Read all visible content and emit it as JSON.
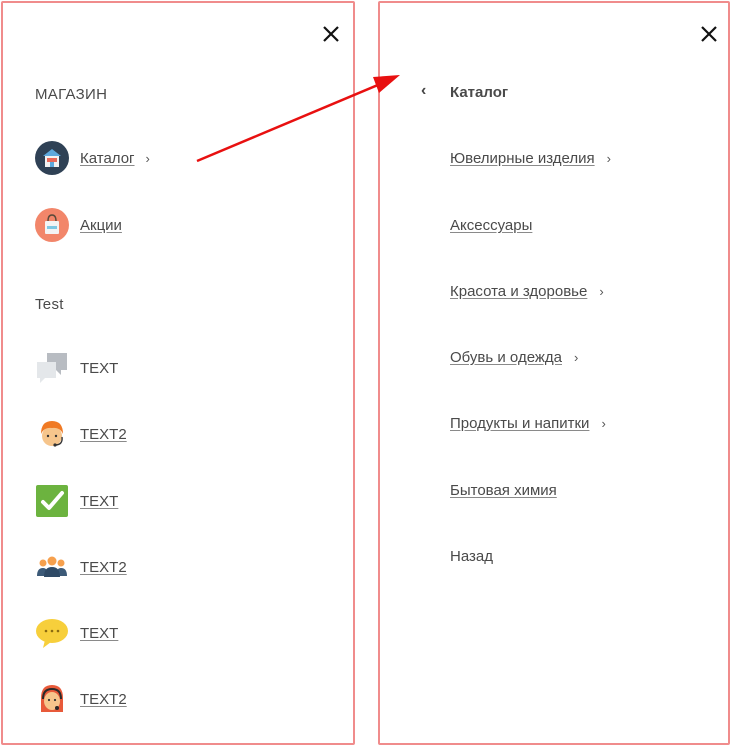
{
  "left_panel": {
    "section_shop": "МАГАЗИН",
    "catalog_label": "Каталог",
    "catalog_chevron": "›",
    "promo_label": "Акции",
    "section_test": "Test",
    "items": [
      {
        "label": "TEXT",
        "icon": "chat-bubbles-icon"
      },
      {
        "label": "TEXT2",
        "icon": "support-agent-icon"
      },
      {
        "label": "TEXT",
        "icon": "checkmark-icon"
      },
      {
        "label": "TEXT2",
        "icon": "team-icon"
      },
      {
        "label": "TEXT",
        "icon": "speech-bubble-icon"
      },
      {
        "label": "TEXT2",
        "icon": "headset-operator-icon"
      }
    ]
  },
  "right_panel": {
    "back_chevron": "‹",
    "title": "Каталог",
    "items": [
      {
        "label": "Ювелирные изделия",
        "has_submenu": true,
        "chevron": "›"
      },
      {
        "label": "Аксессуары",
        "has_submenu": false
      },
      {
        "label": "Красота и здоровье",
        "has_submenu": true,
        "chevron": "›"
      },
      {
        "label": "Обувь и одежда",
        "has_submenu": true,
        "chevron": "›"
      },
      {
        "label": "Продукты и напитки",
        "has_submenu": true,
        "chevron": "›"
      },
      {
        "label": "Бытовая химия",
        "has_submenu": false
      }
    ],
    "back_label": "Назад"
  },
  "colors": {
    "panel_border": "#f08c8c",
    "arrow": "#e81010",
    "text": "#4a4a4a"
  }
}
